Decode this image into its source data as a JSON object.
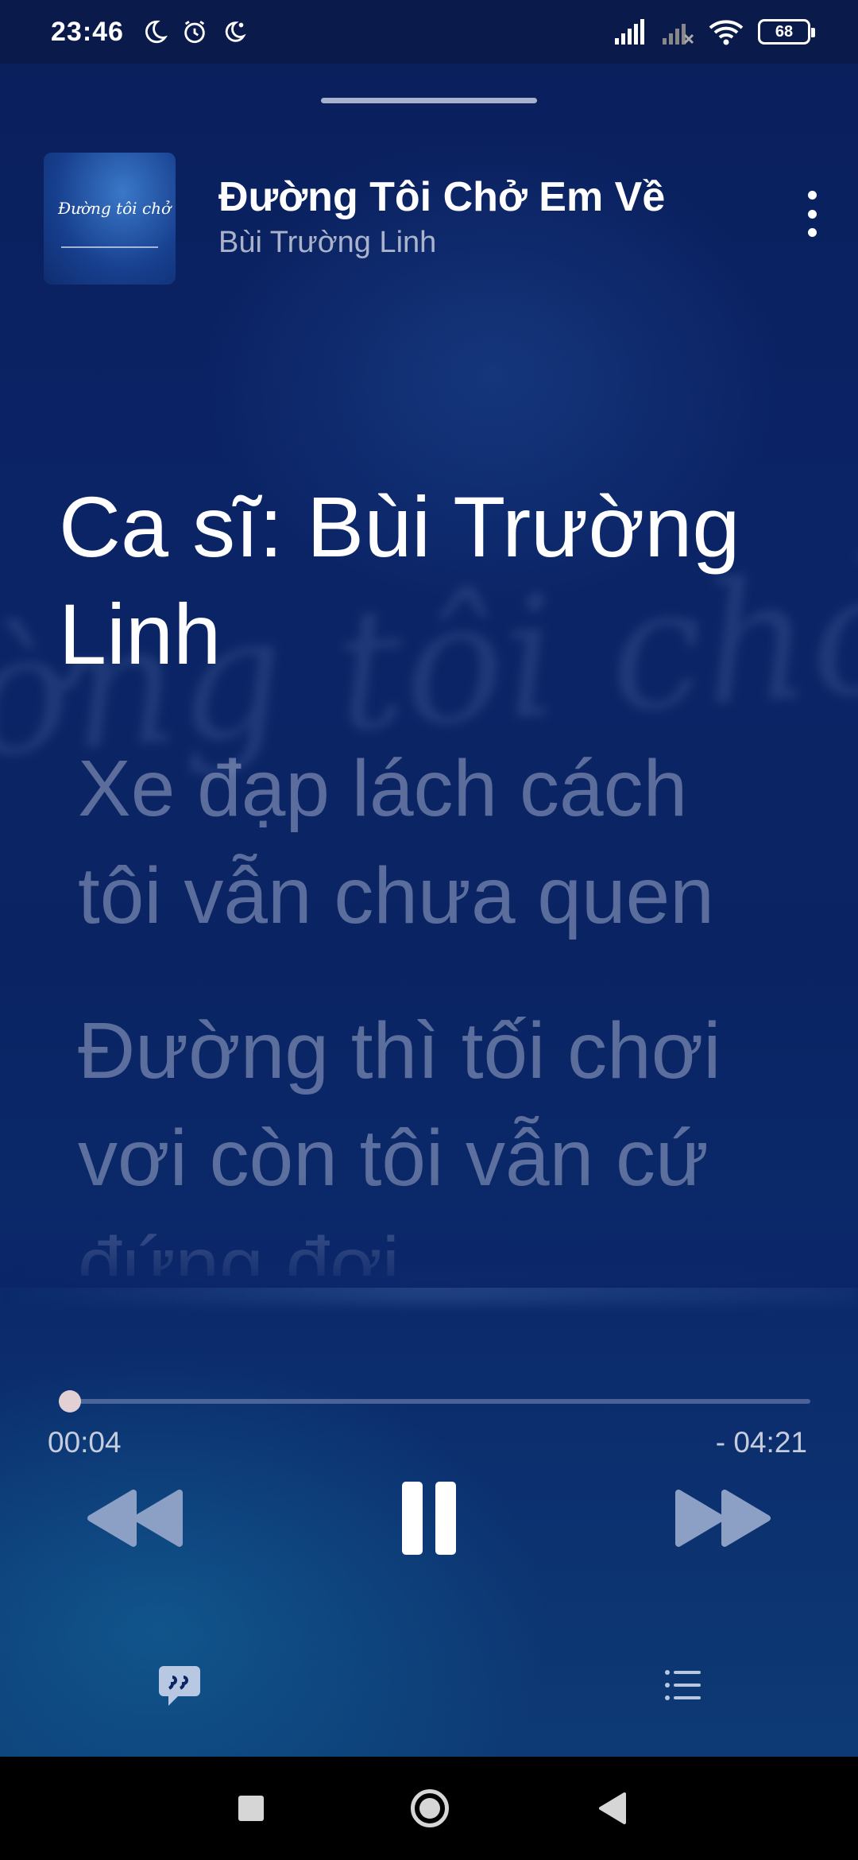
{
  "status_bar": {
    "time": "23:46",
    "left_icons": [
      "moon-icon",
      "alarm-icon",
      "moon-alarm-icon"
    ],
    "right_icons": [
      "signal-icon",
      "signal-no-service-icon",
      "wifi-icon"
    ],
    "battery": "68"
  },
  "player": {
    "album_art_text": "Đường tôi chở em về",
    "title": "Đường Tôi Chở Em Về",
    "artist": "Bùi Trường Linh",
    "lyrics": [
      "Ca sĩ: Bùi Trường Linh",
      "Xe đạp lách cách tôi vẫn chưa quen",
      "Đường thì tối chơi vơi còn tôi vẫn cứ đứng đợi"
    ],
    "active_lyric_index": 0,
    "elapsed": "00:04",
    "remaining": "- 04:21",
    "progress_fraction": 0.015,
    "state": "playing"
  },
  "colors": {
    "background": "#0b2466",
    "accent_thumb": "#e3d0d4",
    "control_dim": "#8ba0c4"
  }
}
